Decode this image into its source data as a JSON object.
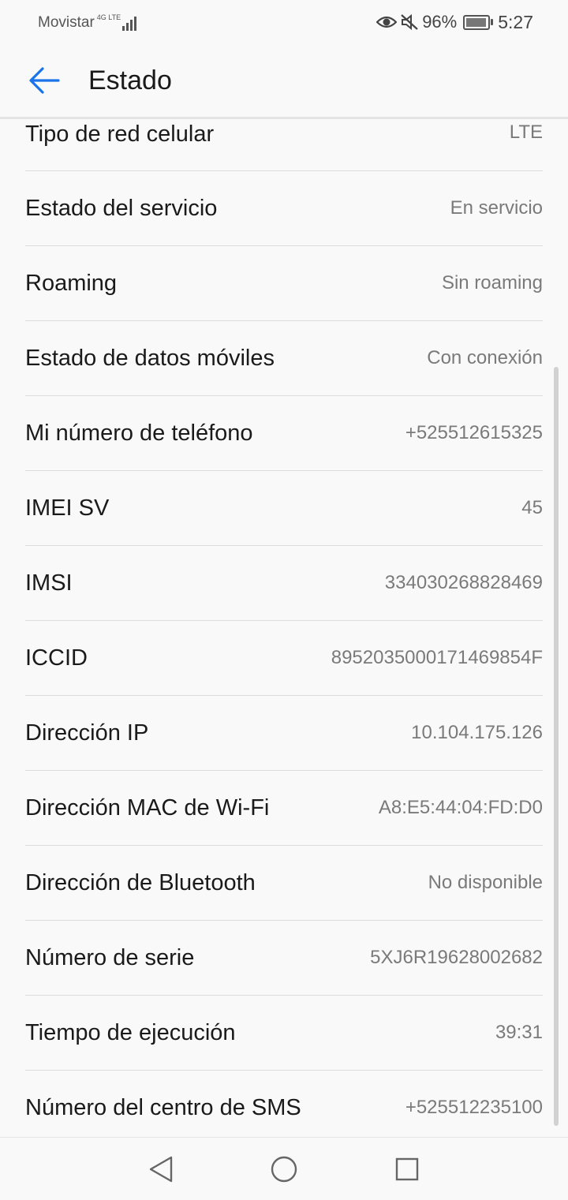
{
  "status_bar": {
    "carrier": "Movistar",
    "network_type": "4G LTE",
    "battery_percent": "96%",
    "time": "5:27",
    "icons": [
      "eye-icon",
      "mute-icon",
      "battery-icon"
    ]
  },
  "header": {
    "title": "Estado",
    "back_icon": "arrow-left-icon"
  },
  "rows": [
    {
      "label": "Tipo de red celular",
      "value": "LTE"
    },
    {
      "label": "Estado del servicio",
      "value": "En servicio"
    },
    {
      "label": "Roaming",
      "value": "Sin roaming"
    },
    {
      "label": "Estado de datos móviles",
      "value": "Con conexión"
    },
    {
      "label": "Mi número de teléfono",
      "value": "+525512615325"
    },
    {
      "label": "IMEI SV",
      "value": "45"
    },
    {
      "label": "IMSI",
      "value": "334030268828469"
    },
    {
      "label": "ICCID",
      "value": "8952035000171469854F"
    },
    {
      "label": "Dirección IP",
      "value": "10.104.175.126"
    },
    {
      "label": "Dirección MAC de Wi-Fi",
      "value": "A8:E5:44:04:FD:D0"
    },
    {
      "label": "Dirección de Bluetooth",
      "value": "No disponible"
    },
    {
      "label": "Número de serie",
      "value": "5XJ6R19628002682"
    },
    {
      "label": "Tiempo de ejecución",
      "value": "39:31"
    },
    {
      "label": "Número del centro de SMS",
      "value": "+525512235100"
    }
  ],
  "nav_bar": {
    "icons": [
      "back-triangle-icon",
      "home-circle-icon",
      "recents-square-icon"
    ]
  },
  "colors": {
    "accent": "#1a73e8",
    "background": "#f9f9f9",
    "label_text": "#1a1a1a",
    "value_text": "#7a7a7a"
  }
}
